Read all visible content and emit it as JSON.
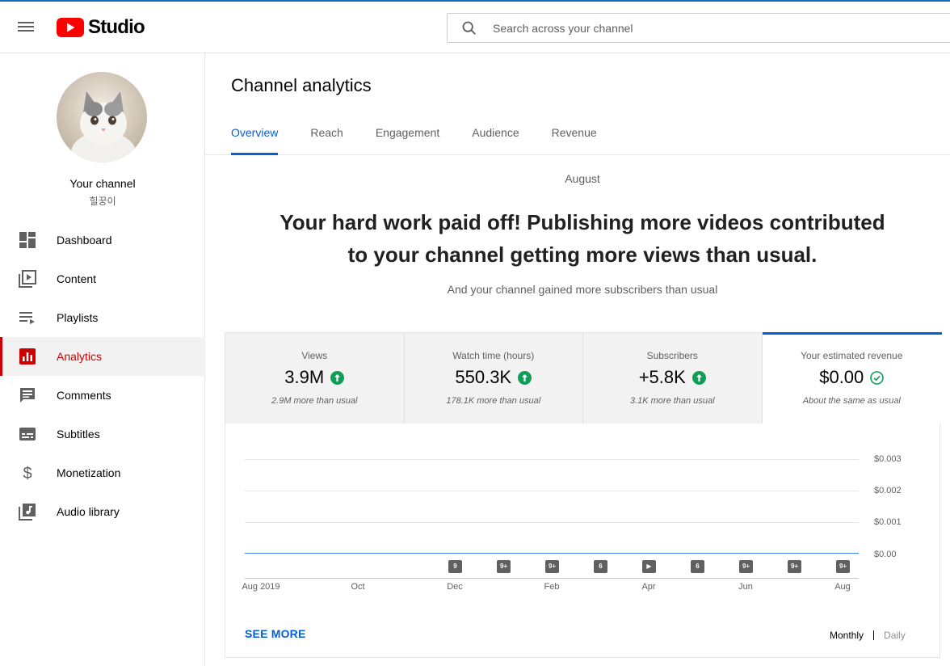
{
  "app": {
    "logo_text": "Studio",
    "search_placeholder": "Search across your channel"
  },
  "channel": {
    "name": "Your channel",
    "handle": "힐꿍이"
  },
  "sidebar": {
    "items": [
      {
        "label": "Dashboard",
        "icon": "dashboard-icon",
        "active": false
      },
      {
        "label": "Content",
        "icon": "content-icon",
        "active": false
      },
      {
        "label": "Playlists",
        "icon": "playlists-icon",
        "active": false
      },
      {
        "label": "Analytics",
        "icon": "analytics-icon",
        "active": true
      },
      {
        "label": "Comments",
        "icon": "comments-icon",
        "active": false
      },
      {
        "label": "Subtitles",
        "icon": "subtitles-icon",
        "active": false
      },
      {
        "label": "Monetization",
        "icon": "dollar-icon",
        "active": false
      },
      {
        "label": "Audio library",
        "icon": "audio-library-icon",
        "active": false
      }
    ]
  },
  "page": {
    "title": "Channel analytics",
    "tabs": [
      "Overview",
      "Reach",
      "Engagement",
      "Audience",
      "Revenue"
    ],
    "active_tab": "Overview"
  },
  "summary": {
    "period": "August",
    "headline_line1": "Your hard work paid off! Publishing more videos contributed",
    "headline_line2": "to your channel getting more views than usual.",
    "subheadline": "And your channel gained more subscribers than usual"
  },
  "metrics": [
    {
      "label": "Views",
      "value": "3.9M",
      "note": "2.9M more than usual",
      "status": "up"
    },
    {
      "label": "Watch time (hours)",
      "value": "550.3K",
      "note": "178.1K more than usual",
      "status": "up"
    },
    {
      "label": "Subscribers",
      "value": "+5.8K",
      "note": "3.1K more than usual",
      "status": "up"
    },
    {
      "label": "Your estimated revenue",
      "value": "$0.00",
      "note": "About the same as usual",
      "status": "same"
    }
  ],
  "chart_data": {
    "type": "line",
    "series": [
      {
        "name": "Your estimated revenue",
        "values": [
          0,
          0,
          0,
          0,
          0,
          0,
          0,
          0,
          0,
          0,
          0,
          0,
          0
        ]
      }
    ],
    "x_tick_labels": [
      "Aug 2019",
      "Oct",
      "Dec",
      "Feb",
      "Apr",
      "Jun",
      "Aug"
    ],
    "y_tick_labels": [
      "$0.003",
      "$0.002",
      "$0.001",
      "$0.00"
    ],
    "ylim": [
      0,
      0.003
    ],
    "grid": true,
    "video_markers": [
      "9",
      "9+",
      "9+",
      "6",
      "▶",
      "6",
      "9+",
      "9+",
      "9+"
    ]
  },
  "footer": {
    "see_more": "SEE MORE",
    "granularity_selected": "Monthly",
    "granularity_other": "Daily"
  },
  "colors": {
    "accent": "#065fd4",
    "brand_red": "#ff0000",
    "nav_active": "#cc0000",
    "up_green": "#0f9d58"
  }
}
